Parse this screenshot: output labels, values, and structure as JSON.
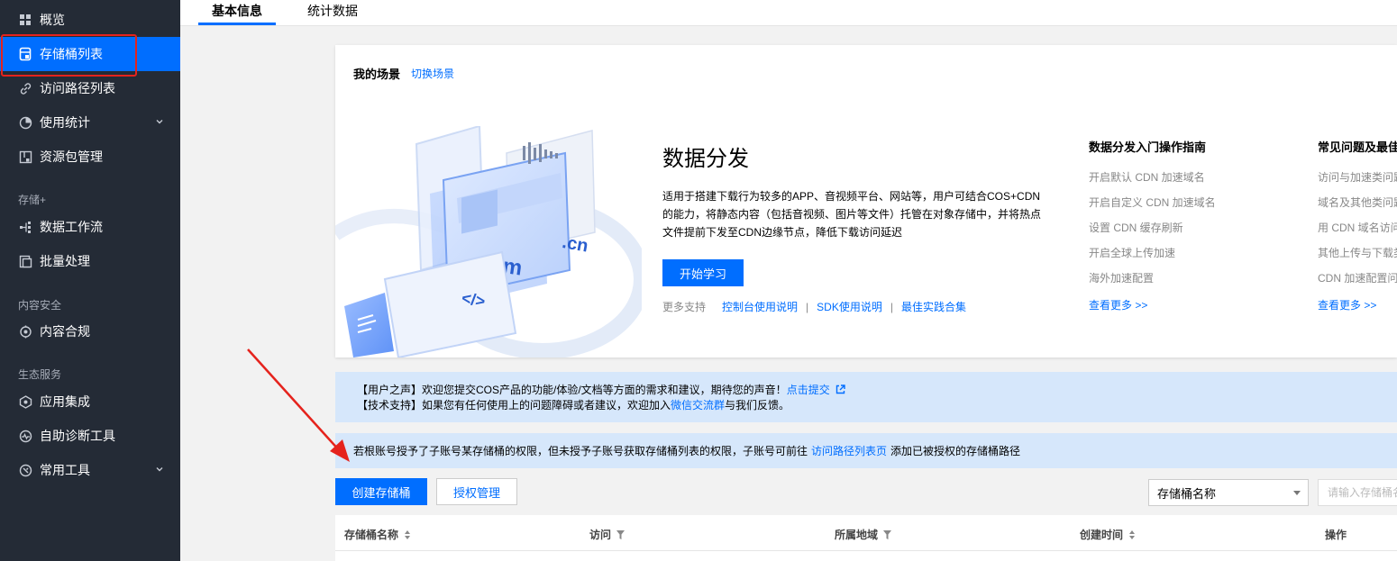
{
  "sidebar": {
    "items": [
      {
        "label": "概览",
        "icon": "grid-icon"
      },
      {
        "label": "存储桶列表",
        "icon": "bucket-icon"
      },
      {
        "label": "访问路径列表",
        "icon": "link-icon"
      },
      {
        "label": "使用统计",
        "icon": "pie-chart-icon"
      },
      {
        "label": "资源包管理",
        "icon": "package-icon"
      },
      {
        "label": "数据工作流",
        "icon": "workflow-icon"
      },
      {
        "label": "批量处理",
        "icon": "batch-icon"
      },
      {
        "label": "内容合规",
        "icon": "compliance-icon"
      },
      {
        "label": "应用集成",
        "icon": "integration-icon"
      },
      {
        "label": "自助诊断工具",
        "icon": "diagnostic-icon"
      },
      {
        "label": "常用工具",
        "icon": "tools-icon"
      }
    ],
    "sections": [
      "存储+",
      "内容安全",
      "生态服务"
    ]
  },
  "tabs": [
    {
      "label": "基本信息"
    },
    {
      "label": "统计数据"
    }
  ],
  "scene": {
    "title": "我的场景",
    "switch_label": "切换场景",
    "heading": "数据分发",
    "description": "适用于搭建下载行为较多的APP、音视频平台、网站等，用户可结合COS+CDN的能力，将静态内容（包括音视频、图片等文件）托管在对象存储中，并将热点文件提前下发至CDN边缘节点，降低下载访问延迟",
    "start_button": "开始学习",
    "support_label": "更多支持",
    "support_links": [
      "控制台使用说明",
      "SDK使用说明",
      "最佳实践合集"
    ],
    "support_sep": "|",
    "illus_text": {
      "com": ".com",
      "cn": ".cn",
      "code": "</>"
    },
    "guide": {
      "title": "数据分发入门操作指南",
      "items": [
        "开启默认 CDN 加速域名",
        "开启自定义 CDN 加速域名",
        "设置 CDN 缓存刷新",
        "开启全球上传加速",
        "海外加速配置"
      ],
      "more": "查看更多 >>"
    },
    "faq": {
      "title": "常见问题及最佳",
      "items": [
        "访问与加速类问题",
        "域名及其他类问题",
        "用 CDN 域名访问",
        "其他上传与下载类",
        "CDN 加速配置问"
      ],
      "more": "查看更多 >>"
    }
  },
  "notice1": {
    "line1": "【用户之声】欢迎您提交COS产品的功能/体验/文档等方面的需求和建议，期待您的声音！",
    "line1_link": "点击提交",
    "line2_prefix": "【技术支持】如果您有任何使用上的问题障碍或者建议，欢迎加入",
    "line2_link": "微信交流群",
    "line2_suffix": "与我们反馈。"
  },
  "notice2": {
    "prefix": "若根账号授予了子账号某存储桶的权限，但未授予子账号获取存储桶列表的权限，子账号可前往",
    "link": "访问路径列表页",
    "suffix": "添加已被授权的存储桶路径"
  },
  "toolbar": {
    "create_label": "创建存储桶",
    "auth_label": "授权管理",
    "select_value": "存储桶名称",
    "search_placeholder": "请输入存储桶名"
  },
  "table": {
    "columns": [
      "存储桶名称",
      "访问",
      "所属地域",
      "创建时间",
      "操作"
    ]
  },
  "colors": {
    "accent": "#006eff",
    "sidebar_bg": "#242b36",
    "notice_bg": "#d6e7fb",
    "highlight": "#e5231d"
  }
}
